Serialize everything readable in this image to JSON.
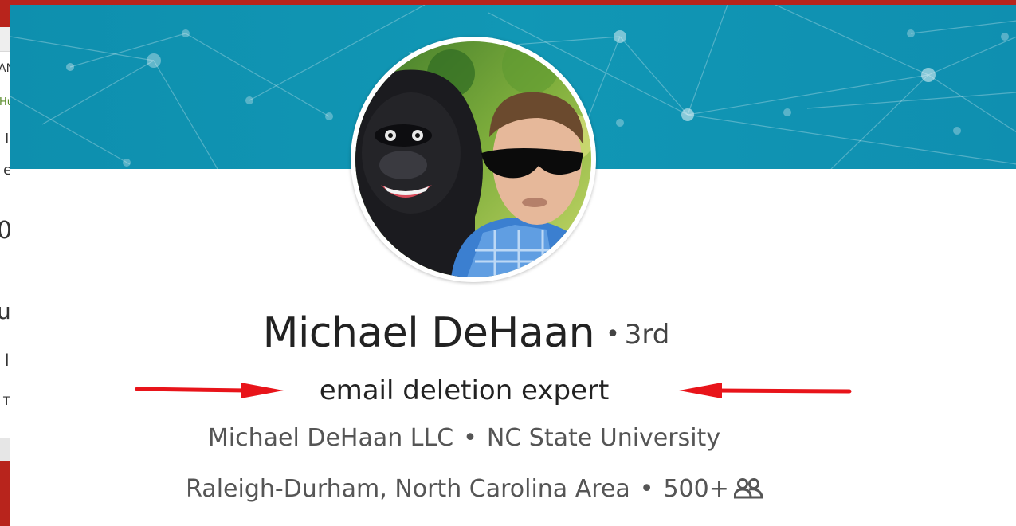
{
  "profile": {
    "name": "Michael DeHaan",
    "degree_separator": "•",
    "degree": "3rd",
    "headline": "email deletion expert",
    "company": "Michael DeHaan LLC",
    "separator": "•",
    "school": "NC State University",
    "location": "Raleigh-Durham, North Carolina Area",
    "connections": "500+"
  },
  "icons": {
    "connections": "connections-icon",
    "arrows": "red-arrow-icon"
  },
  "background_fragments": {
    "line1": "AN",
    "line2": "Hu",
    "line3": "I",
    "line4": "e",
    "line5": "0",
    "line6": "uj",
    "line7": "l",
    "line8": "T"
  },
  "colors": {
    "banner": "#0e8fae",
    "annotation_arrow": "#e8141a",
    "window_red": "#b8241c",
    "text_primary": "#222222",
    "text_secondary": "#555555"
  }
}
